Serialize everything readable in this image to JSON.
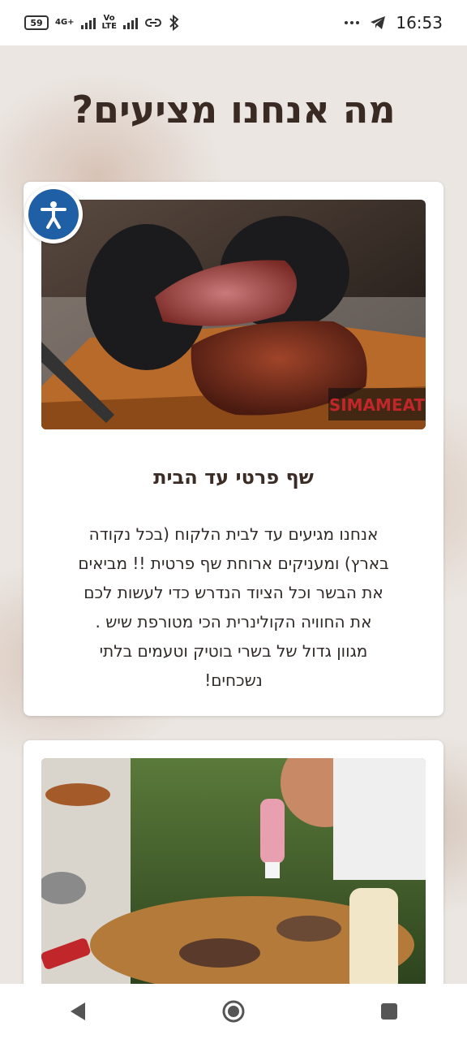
{
  "status_bar": {
    "battery": "59",
    "net_label_top": "4G+",
    "volte_label": "Vo LTE",
    "time": "16:53",
    "icons": [
      "battery-icon",
      "signal-icon",
      "signal-icon",
      "link-icon",
      "bluetooth-icon",
      "more-icon",
      "telegram-icon"
    ]
  },
  "page": {
    "title": "מה אנחנו מציעים?"
  },
  "card1": {
    "photo_logo": "SIMAMEAT",
    "heading": "שף פרטי עד הבית",
    "text": "אנחנו מגיעים עד לבית הלקוח (בכל נקודה\nבארץ) ומעניקים ארוחת שף פרטית !! מביאים\nאת הבשר וכל הציוד הנדרש כדי לעשות לכם\nאת החוויה הקולינרית הכי מטורפת שיש .\nמגוון גדול של בשרי בוטיק וטעמים בלתי\nנשכחים!"
  },
  "accessibility": {
    "icon": "accessibility-icon"
  },
  "nav": {
    "back": "back-icon",
    "home": "home-icon",
    "recents": "recents-icon"
  },
  "colors": {
    "title": "#3a2a24",
    "accent_blue": "#1f5fa5",
    "logo_red": "#c0262a"
  }
}
